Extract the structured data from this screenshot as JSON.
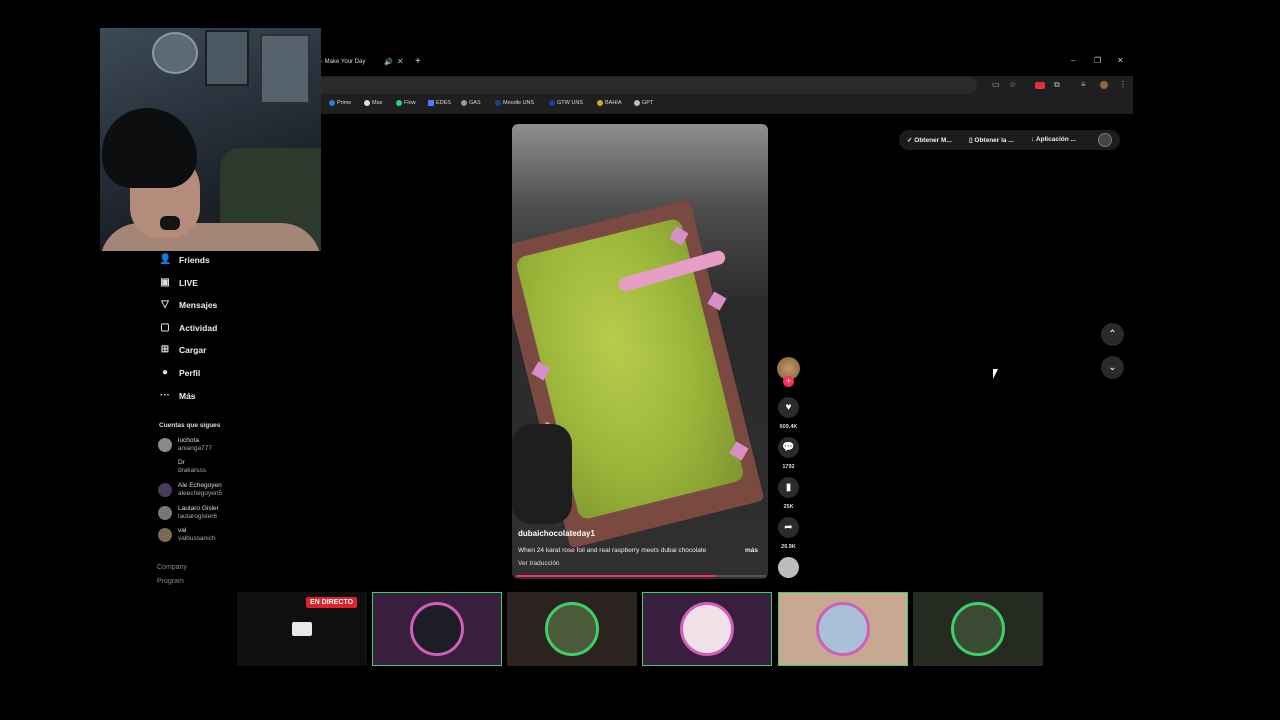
{
  "browser": {
    "tab_title": "- Make Your Day",
    "tab_sound_icon": "speaker-icon",
    "tab_close": "✕",
    "new_tab": "+",
    "window": {
      "minimize": "–",
      "maximize": "❐",
      "close": "✕"
    }
  },
  "bookmarks": [
    {
      "label": "Prime",
      "color": "#2b7cd3"
    },
    {
      "label": "Max",
      "color": "#dddddd"
    },
    {
      "label": "Flow",
      "color": "#2fd17a"
    },
    {
      "label": "EDES",
      "color": "#4f7cff"
    },
    {
      "label": "GAS",
      "color": "#999999"
    },
    {
      "label": "Moodle UNS",
      "color": "#1b3f8b"
    },
    {
      "label": "GTW UNS",
      "color": "#2436a8"
    },
    {
      "label": "BAHIA",
      "color": "#d1a43a"
    },
    {
      "label": "GPT",
      "color": "#bbbbbb"
    }
  ],
  "sidebar": {
    "items": [
      {
        "label": "Friends",
        "icon": "friends-icon"
      },
      {
        "label": "LIVE",
        "icon": "live-icon"
      },
      {
        "label": "Mensajes",
        "icon": "messages-icon"
      },
      {
        "label": "Actividad",
        "icon": "activity-icon"
      },
      {
        "label": "Cargar",
        "icon": "upload-icon"
      },
      {
        "label": "Perfil",
        "icon": "profile-icon"
      },
      {
        "label": "Más",
        "icon": "more-icon"
      }
    ],
    "following_title": "Cuentas que sigues",
    "accounts": [
      {
        "name": "luchota",
        "user": "anianga777"
      },
      {
        "name": "Dr",
        "user": "drakarsss"
      },
      {
        "name": "Ale Echegoyen",
        "user": "aleechegoyen5"
      },
      {
        "name": "Lautaro Gisler",
        "user": "lautarogisler6"
      },
      {
        "name": "val",
        "user": "valbussanich"
      }
    ],
    "footer": {
      "company": "Company",
      "program": "Program"
    }
  },
  "extensions": {
    "btn1": "Obtener M...",
    "btn2": "Obtener la ...",
    "btn3": "Aplicación ..."
  },
  "video": {
    "username": "dubaichocolateday1",
    "caption": "When 24 karat rose foil and real raspberry meets dubai chocolate",
    "more": "más",
    "translate": "Ver traducción",
    "progress": 0.8,
    "likes": "609.4K",
    "comments": "1792",
    "saves": "25K",
    "shares": "26.9K"
  },
  "stream": {
    "live_badge": "EN DIRECTO"
  }
}
